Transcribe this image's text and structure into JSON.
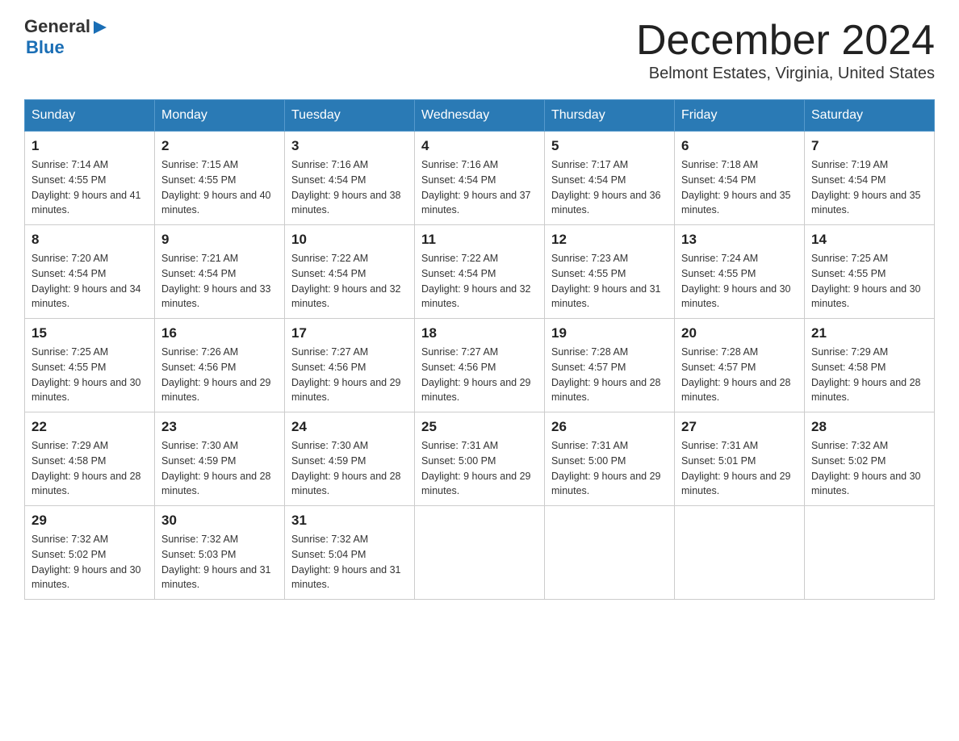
{
  "header": {
    "logo_general": "General",
    "logo_blue": "Blue",
    "title": "December 2024",
    "subtitle": "Belmont Estates, Virginia, United States"
  },
  "days_of_week": [
    "Sunday",
    "Monday",
    "Tuesday",
    "Wednesday",
    "Thursday",
    "Friday",
    "Saturday"
  ],
  "weeks": [
    [
      {
        "day": "1",
        "sunrise": "7:14 AM",
        "sunset": "4:55 PM",
        "daylight": "9 hours and 41 minutes."
      },
      {
        "day": "2",
        "sunrise": "7:15 AM",
        "sunset": "4:55 PM",
        "daylight": "9 hours and 40 minutes."
      },
      {
        "day": "3",
        "sunrise": "7:16 AM",
        "sunset": "4:54 PM",
        "daylight": "9 hours and 38 minutes."
      },
      {
        "day": "4",
        "sunrise": "7:16 AM",
        "sunset": "4:54 PM",
        "daylight": "9 hours and 37 minutes."
      },
      {
        "day": "5",
        "sunrise": "7:17 AM",
        "sunset": "4:54 PM",
        "daylight": "9 hours and 36 minutes."
      },
      {
        "day": "6",
        "sunrise": "7:18 AM",
        "sunset": "4:54 PM",
        "daylight": "9 hours and 35 minutes."
      },
      {
        "day": "7",
        "sunrise": "7:19 AM",
        "sunset": "4:54 PM",
        "daylight": "9 hours and 35 minutes."
      }
    ],
    [
      {
        "day": "8",
        "sunrise": "7:20 AM",
        "sunset": "4:54 PM",
        "daylight": "9 hours and 34 minutes."
      },
      {
        "day": "9",
        "sunrise": "7:21 AM",
        "sunset": "4:54 PM",
        "daylight": "9 hours and 33 minutes."
      },
      {
        "day": "10",
        "sunrise": "7:22 AM",
        "sunset": "4:54 PM",
        "daylight": "9 hours and 32 minutes."
      },
      {
        "day": "11",
        "sunrise": "7:22 AM",
        "sunset": "4:54 PM",
        "daylight": "9 hours and 32 minutes."
      },
      {
        "day": "12",
        "sunrise": "7:23 AM",
        "sunset": "4:55 PM",
        "daylight": "9 hours and 31 minutes."
      },
      {
        "day": "13",
        "sunrise": "7:24 AM",
        "sunset": "4:55 PM",
        "daylight": "9 hours and 30 minutes."
      },
      {
        "day": "14",
        "sunrise": "7:25 AM",
        "sunset": "4:55 PM",
        "daylight": "9 hours and 30 minutes."
      }
    ],
    [
      {
        "day": "15",
        "sunrise": "7:25 AM",
        "sunset": "4:55 PM",
        "daylight": "9 hours and 30 minutes."
      },
      {
        "day": "16",
        "sunrise": "7:26 AM",
        "sunset": "4:56 PM",
        "daylight": "9 hours and 29 minutes."
      },
      {
        "day": "17",
        "sunrise": "7:27 AM",
        "sunset": "4:56 PM",
        "daylight": "9 hours and 29 minutes."
      },
      {
        "day": "18",
        "sunrise": "7:27 AM",
        "sunset": "4:56 PM",
        "daylight": "9 hours and 29 minutes."
      },
      {
        "day": "19",
        "sunrise": "7:28 AM",
        "sunset": "4:57 PM",
        "daylight": "9 hours and 28 minutes."
      },
      {
        "day": "20",
        "sunrise": "7:28 AM",
        "sunset": "4:57 PM",
        "daylight": "9 hours and 28 minutes."
      },
      {
        "day": "21",
        "sunrise": "7:29 AM",
        "sunset": "4:58 PM",
        "daylight": "9 hours and 28 minutes."
      }
    ],
    [
      {
        "day": "22",
        "sunrise": "7:29 AM",
        "sunset": "4:58 PM",
        "daylight": "9 hours and 28 minutes."
      },
      {
        "day": "23",
        "sunrise": "7:30 AM",
        "sunset": "4:59 PM",
        "daylight": "9 hours and 28 minutes."
      },
      {
        "day": "24",
        "sunrise": "7:30 AM",
        "sunset": "4:59 PM",
        "daylight": "9 hours and 28 minutes."
      },
      {
        "day": "25",
        "sunrise": "7:31 AM",
        "sunset": "5:00 PM",
        "daylight": "9 hours and 29 minutes."
      },
      {
        "day": "26",
        "sunrise": "7:31 AM",
        "sunset": "5:00 PM",
        "daylight": "9 hours and 29 minutes."
      },
      {
        "day": "27",
        "sunrise": "7:31 AM",
        "sunset": "5:01 PM",
        "daylight": "9 hours and 29 minutes."
      },
      {
        "day": "28",
        "sunrise": "7:32 AM",
        "sunset": "5:02 PM",
        "daylight": "9 hours and 30 minutes."
      }
    ],
    [
      {
        "day": "29",
        "sunrise": "7:32 AM",
        "sunset": "5:02 PM",
        "daylight": "9 hours and 30 minutes."
      },
      {
        "day": "30",
        "sunrise": "7:32 AM",
        "sunset": "5:03 PM",
        "daylight": "9 hours and 31 minutes."
      },
      {
        "day": "31",
        "sunrise": "7:32 AM",
        "sunset": "5:04 PM",
        "daylight": "9 hours and 31 minutes."
      },
      null,
      null,
      null,
      null
    ]
  ]
}
